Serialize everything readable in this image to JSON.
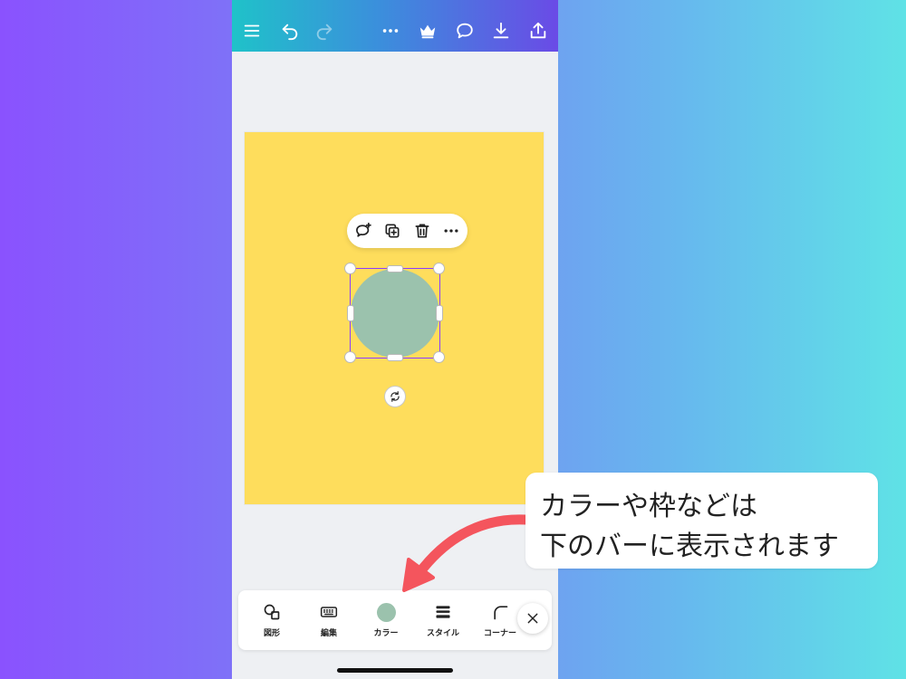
{
  "toolbar": {
    "icons": [
      "menu-icon",
      "undo-icon",
      "redo-icon",
      "more-icon",
      "crown-icon",
      "comment-icon",
      "download-icon",
      "share-icon"
    ]
  },
  "context_menu": {
    "icons": [
      "comment-add-icon",
      "duplicate-icon",
      "trash-icon",
      "more-icon"
    ]
  },
  "shape": {
    "fill_color": "#9bc2ad"
  },
  "page": {
    "background_color": "#fedd5c"
  },
  "bottom_toolbar": {
    "tools": [
      {
        "name": "shape",
        "label": "図形",
        "icon": "shapes-icon"
      },
      {
        "name": "edit",
        "label": "編集",
        "icon": "keyboard-icon"
      },
      {
        "name": "color",
        "label": "カラー",
        "icon": "color-swatch-icon"
      },
      {
        "name": "style",
        "label": "スタイル",
        "icon": "border-style-icon"
      },
      {
        "name": "corner",
        "label": "コーナー",
        "icon": "corner-icon"
      }
    ],
    "close_icon": "close-icon"
  },
  "callout": {
    "line1": "カラーや枠などは",
    "line2": "下のバーに表示されます"
  },
  "colors": {
    "accent": "#8b3dff",
    "arrow": "#f4555d"
  }
}
